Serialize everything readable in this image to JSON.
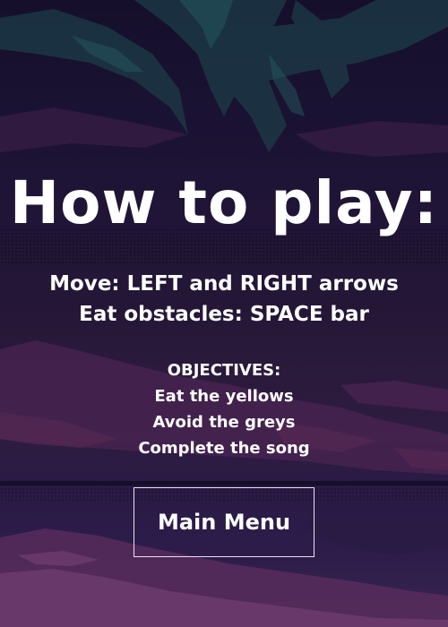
{
  "screen": {
    "title": "How to play:",
    "controls": [
      "Move: LEFT and RIGHT arrows",
      "Eat obstacles: SPACE bar"
    ],
    "objectives": {
      "heading": "OBJECTIVES:",
      "items": [
        "Eat the yellows",
        "Avoid the greys",
        "Complete the song"
      ]
    },
    "main_menu_label": "Main Menu"
  },
  "colors": {
    "background": "#1b1234",
    "text": "#ffffff",
    "palm_leaves": "#1e4a52",
    "clouds": "#5a2a52",
    "button_border": "#e8e4f0"
  },
  "icons": [
    "palm-tree-silhouette",
    "pixel-clouds"
  ]
}
